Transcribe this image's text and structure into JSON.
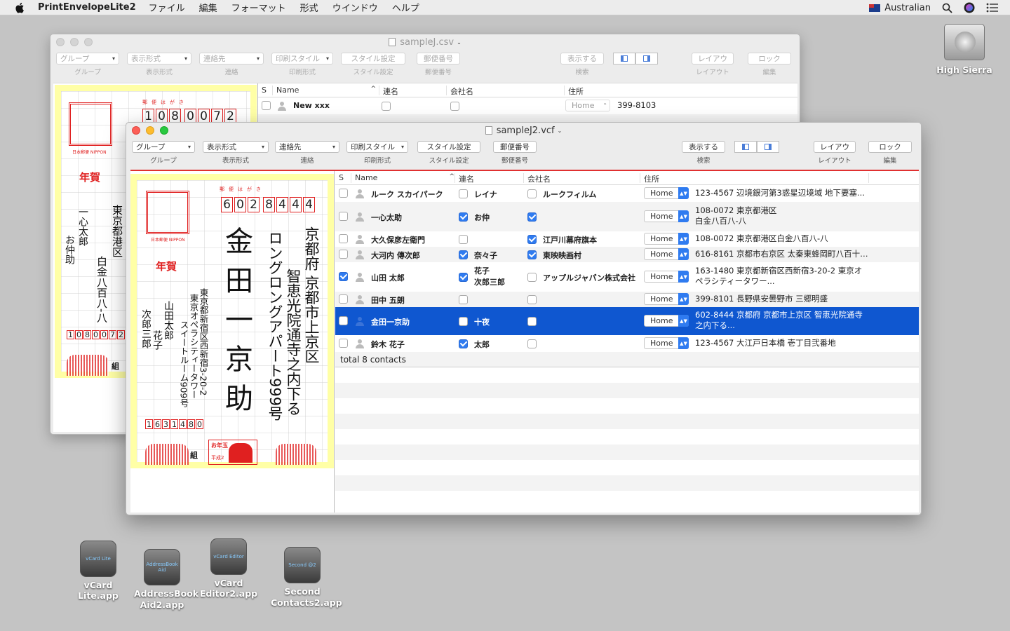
{
  "menubar": {
    "app_name": "PrintEnvelopeLite2",
    "items": [
      "ファイル",
      "編集",
      "フォーマット",
      "形式",
      "ウインドウ",
      "ヘルプ"
    ],
    "input_source": "Australian"
  },
  "desktop": {
    "drive_label": "High Sierra",
    "apps": [
      {
        "name": "vCard Lite.app",
        "tile": "vCard Lite"
      },
      {
        "name": "AddressBook Aid2.app",
        "tile": "AddressBook Aid"
      },
      {
        "name": "vCard Editor2.app",
        "tile": "vCard Editor"
      },
      {
        "name": "Second Contacts2.app",
        "tile": "Second @2"
      }
    ]
  },
  "toolbar": {
    "group": {
      "value": "グループ",
      "caption": "グループ"
    },
    "display_format": {
      "value": "表示形式",
      "caption": "表示形式"
    },
    "contact": {
      "value": "連絡先",
      "caption": "連絡"
    },
    "print_style": {
      "value": "印刷スタイル",
      "caption": "印刷形式"
    },
    "style_settings": {
      "label": "スタイル設定",
      "caption": "スタイル設定"
    },
    "postal_code": {
      "label": "郵便番号",
      "caption": "郵便番号"
    },
    "show": {
      "label": "表示する",
      "caption": "検索"
    },
    "layout": {
      "label": "レイアウ",
      "caption": "レイアウト"
    },
    "lock": {
      "label": "ロック",
      "caption": "編集"
    }
  },
  "back_window": {
    "title": "sampleJ.csv",
    "columns": [
      "S",
      "Name",
      "連名",
      "会社名",
      "住所"
    ],
    "rows": [
      {
        "name": "New xxx",
        "addr_type": "Home",
        "address": "399-8103"
      }
    ],
    "card": {
      "zip": [
        "1",
        "0",
        "8",
        "0",
        "0",
        "7",
        "2"
      ],
      "address_lines": [
        "東京都港区",
        "白金八百八-八"
      ],
      "name": "一心太郎",
      "partner": "お仲助",
      "sender_zip": [
        "1",
        "0",
        "8",
        "0",
        "0",
        "7",
        "2"
      ],
      "nenga": "年賀",
      "kumi": "組",
      "postcard_label": "郵便はがき",
      "stamp_caption": "日本郵便 NIPPON"
    }
  },
  "front_window": {
    "title": "sampleJ2.vcf",
    "columns": [
      "S",
      "Name",
      "連名",
      "会社名",
      "住所"
    ],
    "rows": [
      {
        "s": false,
        "name": "ルーク スカイパーク",
        "joint_on": false,
        "joint": "レイナ",
        "co_on": false,
        "company": "ルークフィルム",
        "addr_type": "Home",
        "address": "123-4567 辺境銀河第3惑星辺境域 地下要塞..."
      },
      {
        "s": false,
        "name": "一心太助",
        "joint_on": true,
        "joint": "お仲",
        "co_on": true,
        "company": "",
        "addr_type": "Home",
        "address": "108-0072 東京都港区\n白金八百八-八"
      },
      {
        "s": false,
        "name": "大久保彦左衛門",
        "joint_on": false,
        "joint": "",
        "co_on": true,
        "company": "江戸川幕府旗本",
        "addr_type": "Home",
        "address": "108-0072 東京都港区白金八百八-八"
      },
      {
        "s": false,
        "name": "大河内 傳次郎",
        "joint_on": true,
        "joint": "奈々子",
        "co_on": true,
        "company": "東映映画村",
        "addr_type": "Home",
        "address": "616-8161 京都市右京区 太秦東蜂岡町八百十…"
      },
      {
        "s": true,
        "name": "山田 太郎",
        "joint_on": true,
        "joint": "花子\n次郎三郎",
        "co_on": false,
        "company": "アップルジャパン株式会社",
        "addr_type": "Home",
        "address": "163-1480 東京都新宿区西新宿3-20-2 東京オ\nペラシティータワー..."
      },
      {
        "s": false,
        "name": "田中 五朗",
        "joint_on": false,
        "joint": "",
        "co_on": false,
        "company": "",
        "addr_type": "Home",
        "address": "399-8101 長野県安曇野市 三郷明盛"
      },
      {
        "s": false,
        "name": "金田一京助",
        "joint_on": false,
        "joint": "十夜",
        "co_on": false,
        "company": "",
        "addr_type": "Home",
        "address": "602-8444 京都府 京都市上京区 智恵光院通寺\n之内下る..."
      },
      {
        "s": false,
        "name": "鈴木 花子",
        "joint_on": true,
        "joint": "太郎",
        "co_on": false,
        "company": "",
        "addr_type": "Home",
        "address": "123-4567 大江戸日本橋 壱丁目弐番地"
      }
    ],
    "total": "total 8 contacts",
    "card": {
      "zip": [
        "6",
        "0",
        "2",
        "8",
        "4",
        "4",
        "4"
      ],
      "address1": "京都府 京都市上京区",
      "address2": "智恵光院通寺之内下る",
      "address3": "ロングロングアパート999号",
      "name": "金田一京助",
      "sender_address1": "東京都新宿区西新宿3-20-2",
      "sender_address2": "東京オペラシティータワー",
      "sender_address3": "スイートルーム909号",
      "sender_name": "山田太郎",
      "sender_partner1": "花子",
      "sender_partner2": "次郎三郎",
      "sender_zip": [
        "1",
        "6",
        "3",
        "1",
        "4",
        "8",
        "0"
      ],
      "nenga": "年賀",
      "kumi": "組",
      "postcard_label": "郵便はがき",
      "stamp_caption": "日本郵便 NIPPON",
      "otoshidama": "お年玉",
      "heisei": "平成2"
    }
  }
}
